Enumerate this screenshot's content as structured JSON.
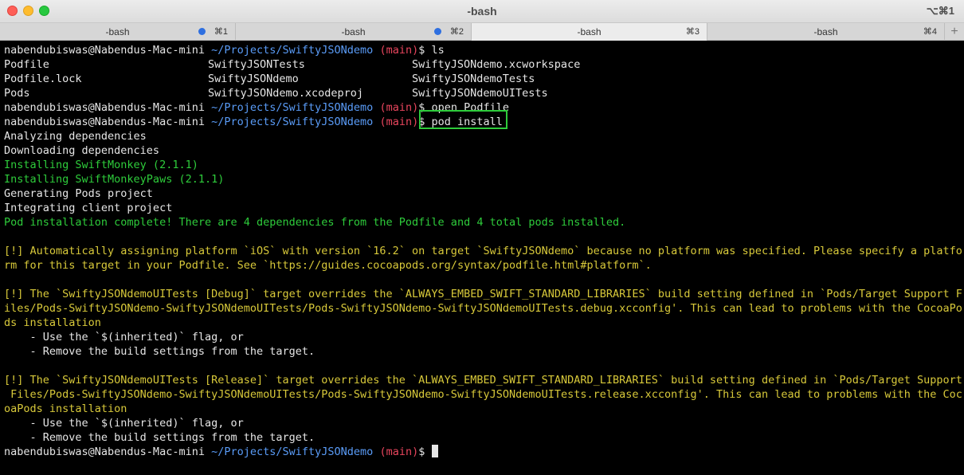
{
  "window": {
    "title": "-bash",
    "shortcut": "⌥⌘1"
  },
  "tabs": [
    {
      "label": "-bash",
      "key": "⌘1",
      "active": false,
      "bell": true
    },
    {
      "label": "-bash",
      "key": "⌘2",
      "active": false,
      "bell": true
    },
    {
      "label": "-bash",
      "key": "⌘3",
      "active": true,
      "bell": false
    },
    {
      "label": "-bash",
      "key": "⌘4",
      "active": false,
      "bell": false
    }
  ],
  "new_tab_label": "+",
  "prompt": {
    "user": "nabendubiswas@Nabendus-Mac-mini",
    "path": "~/Projects/SwiftyJSONdemo",
    "branch": "(main)",
    "symbol": "$"
  },
  "commands": {
    "ls": " ls",
    "open": " open Podfile",
    "pod": "pod install"
  },
  "ls_output": [
    [
      "Podfile",
      "SwiftyJSONTests",
      "SwiftyJSONdemo.xcworkspace"
    ],
    [
      "Podfile.lock",
      "SwiftyJSONdemo",
      "SwiftyJSONdemoTests"
    ],
    [
      "Pods",
      "SwiftyJSONdemo.xcodeproj",
      "SwiftyJSONdemoUITests"
    ]
  ],
  "output": {
    "analyzing": "Analyzing dependencies",
    "downloading": "Downloading dependencies",
    "install1": "Installing SwiftMonkey (2.1.1)",
    "install2": "Installing SwiftMonkeyPaws (2.1.1)",
    "generating": "Generating Pods project",
    "integrating": "Integrating client project",
    "complete": "Pod installation complete! There are 4 dependencies from the Podfile and 4 total pods installed.",
    "warn1_l1": "[!] Automatically assigning platform `iOS` with version `16.2` on target `SwiftyJSONdemo` because no platform was specified. Please specify a platfo",
    "warn1_l2": "rm for this target in your Podfile. See `https://guides.cocoapods.org/syntax/podfile.html#platform`.",
    "warn2_l1": "[!] The `SwiftyJSONdemoUITests [Debug]` target overrides the `ALWAYS_EMBED_SWIFT_STANDARD_LIBRARIES` build setting defined in `Pods/Target Support F",
    "warn2_l2": "iles/Pods-SwiftyJSONdemo-SwiftyJSONdemoUITests/Pods-SwiftyJSONdemo-SwiftyJSONdemoUITests.debug.xcconfig'. This can lead to problems with the CocoaPo",
    "warn2_l3": "ds installation",
    "warn2_b1": "    - Use the `$(inherited)` flag, or",
    "warn2_b2": "    - Remove the build settings from the target.",
    "warn3_l1": "[!] The `SwiftyJSONdemoUITests [Release]` target overrides the `ALWAYS_EMBED_SWIFT_STANDARD_LIBRARIES` build setting defined in `Pods/Target Support",
    "warn3_l2": " Files/Pods-SwiftyJSONdemo-SwiftyJSONdemoUITests/Pods-SwiftyJSONdemo-SwiftyJSONdemoUITests.release.xcconfig'. This can lead to problems with the Coc",
    "warn3_l3": "oaPods installation",
    "warn3_b1": "    - Use the `$(inherited)` flag, or",
    "warn3_b2": "    - Remove the build settings from the target."
  },
  "colors": {
    "path": "#5a9cf8",
    "branch": "#e8455d",
    "success": "#2ecc3b",
    "warning": "#d8c93a",
    "highlight": "#2ecc3b"
  }
}
